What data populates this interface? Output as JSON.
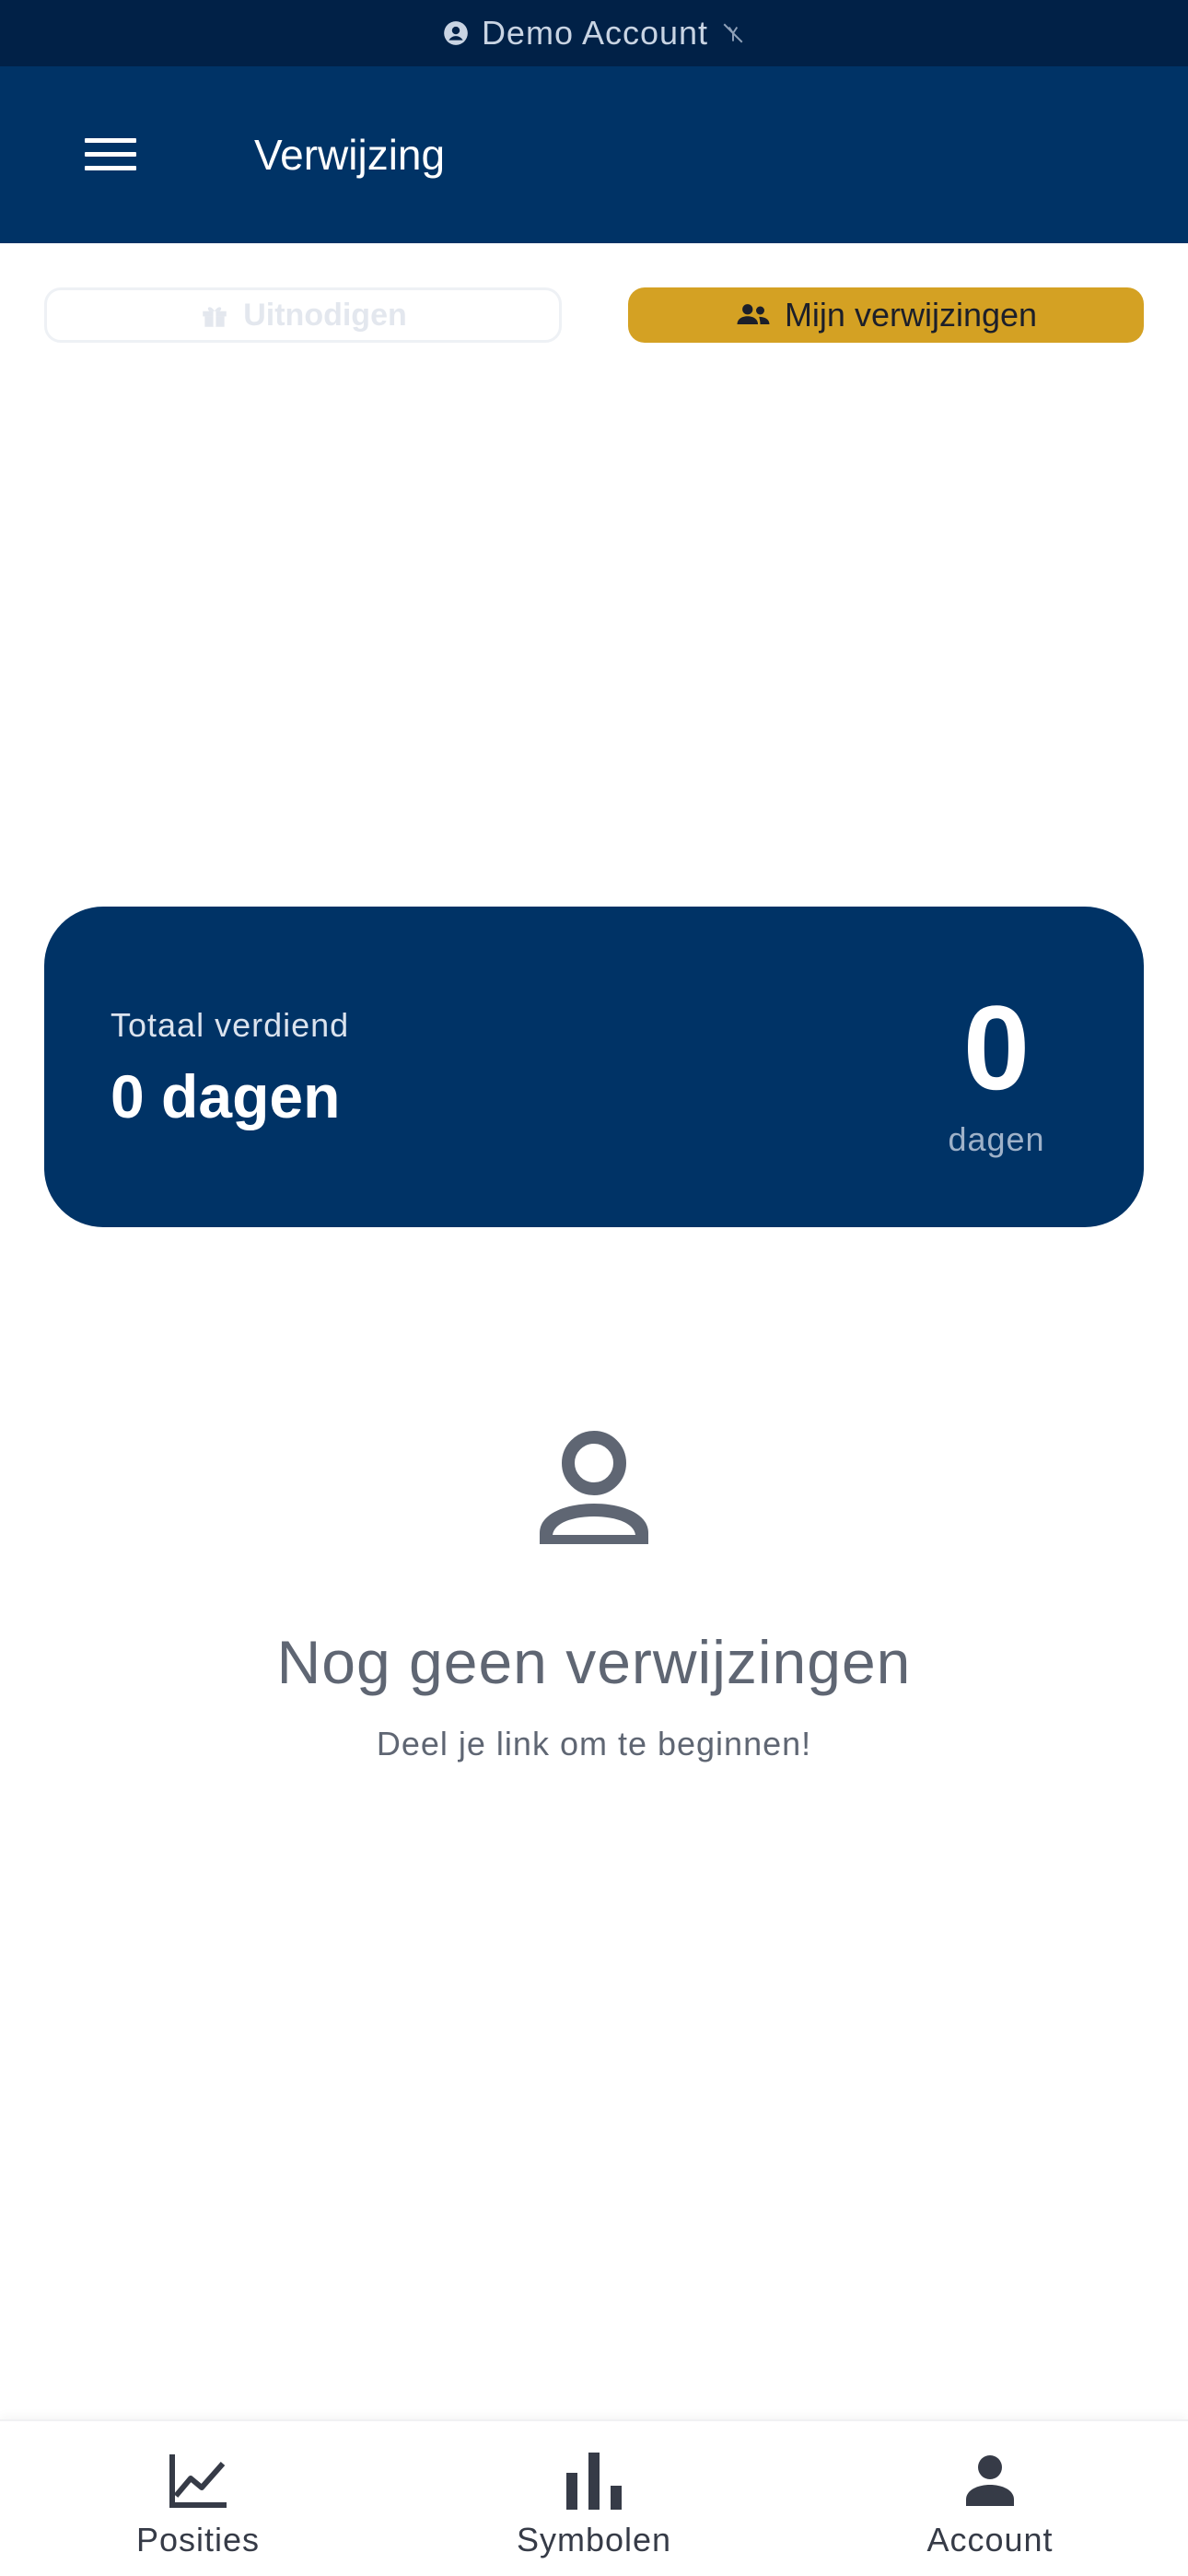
{
  "banner": {
    "text": "Demo Account",
    "icon_left": "account-circle-icon",
    "icon_right": "no-signal-icon"
  },
  "app_bar": {
    "title": "Verwijzing",
    "menu_icon": "hamburger-menu-icon"
  },
  "tabs": {
    "invite_label": "Uitnodigen",
    "invite_icon": "gift-icon",
    "referrals_label": "Mijn verwijzingen",
    "referrals_icon": "people-icon",
    "active_color": "#d4a123"
  },
  "earnings": {
    "label": "Totaal verdiend",
    "value": "0 dagen",
    "big_number": "0",
    "big_unit": "dagen",
    "card_color": "#003366"
  },
  "empty_state": {
    "icon": "person-outline-icon",
    "title": "Nog geen verwijzingen",
    "subtitle": "Deel je link om te beginnen!"
  },
  "bottom_nav": {
    "items": [
      {
        "label": "Posities",
        "icon": "line-chart-icon"
      },
      {
        "label": "Symbolen",
        "icon": "bar-chart-icon"
      },
      {
        "label": "Account",
        "icon": "person-icon"
      }
    ]
  }
}
